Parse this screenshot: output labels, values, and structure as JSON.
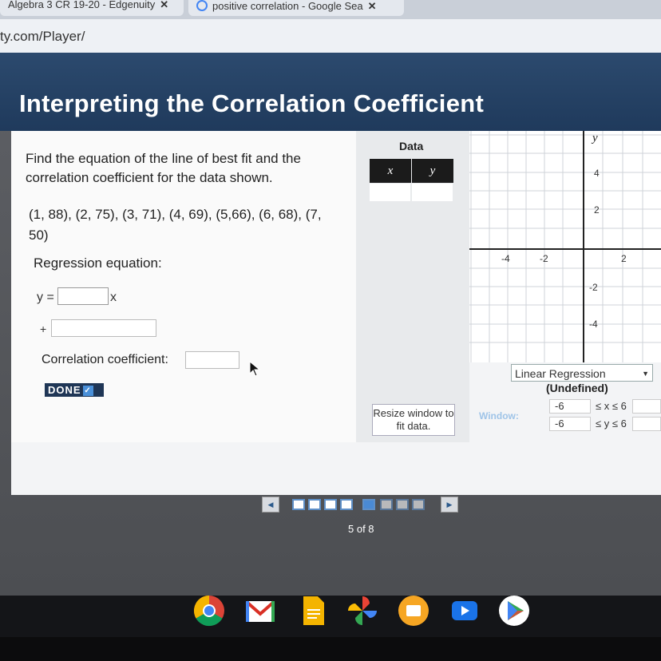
{
  "browser": {
    "tabs": [
      {
        "label": "Algebra 3 CR 19-20 - Edgenuity",
        "close": "✕"
      },
      {
        "label": "positive correlation - Google Sea",
        "close": "✕"
      }
    ],
    "url": "ty.com/Player/"
  },
  "lesson": {
    "title": "Interpreting the Correlation Coefficient",
    "instruction": "Find the equation of the line of best fit and the correlation coefficient for the data shown.",
    "points": "(1, 88), (2, 75), (3, 71), (4, 69), (5,66), (6, 68), (7, 50)",
    "regression_label": "Regression equation:",
    "y_prefix": "y =",
    "x_suffix": "x",
    "plus": "+",
    "correlation_label": "Correlation coefficient:",
    "done_label": "DONE",
    "done_check": "✓"
  },
  "data_table": {
    "title": "Data",
    "columns": [
      "x",
      "y"
    ]
  },
  "graph": {
    "axis_label_y": "y",
    "x_ticks": [
      "-4",
      "-2",
      "2"
    ],
    "y_ticks": [
      "4",
      "2",
      "-2",
      "-4"
    ],
    "regression_select": "Linear Regression",
    "regression_result": "(Undefined)",
    "resize_button": "Resize window to fit data.",
    "window_label": "Window:",
    "x_min": "-6",
    "x_range_text": "≤ x ≤ 6",
    "y_min": "-6",
    "y_range_text": "≤ y ≤ 6"
  },
  "pager": {
    "prev_icon": "◀",
    "next_icon": "▶",
    "current": 5,
    "total": 8,
    "label": "5 of 8"
  },
  "colors": {
    "title_band": "#1f3a5c",
    "accent_blue": "#4a8ad4",
    "done_bg": "#1f3656"
  },
  "taskbar_icons": [
    "chrome-icon",
    "gmail-icon",
    "docs-icon",
    "photos-icon",
    "files-icon",
    "youtube-icon",
    "play-store-icon"
  ]
}
